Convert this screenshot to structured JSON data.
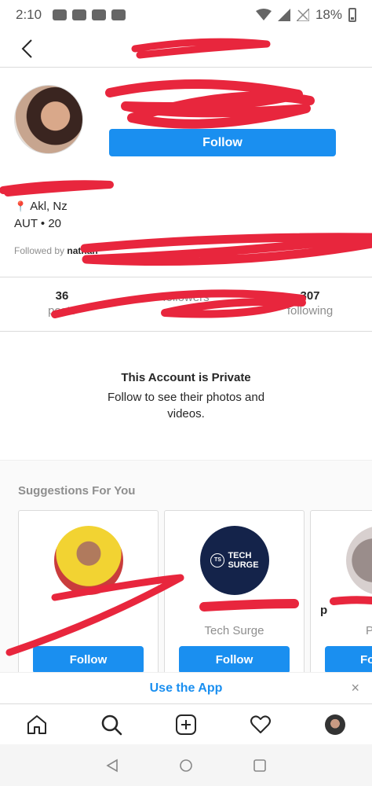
{
  "status_bar": {
    "time": "2:10",
    "battery": "18%"
  },
  "header": {
    "username": ""
  },
  "profile": {
    "follow_label": "Follow",
    "location": "Akl, Nz",
    "info": "AUT • 20",
    "followed_by_prefix": "Followed by",
    "followed_by_name": "nathan"
  },
  "stats": [
    {
      "num": "36",
      "label": "posts"
    },
    {
      "num": "",
      "label": "followers"
    },
    {
      "num": "307",
      "label": "following"
    }
  ],
  "private": {
    "title": "This Account is Private",
    "subtitle": "Follow to see their photos and videos."
  },
  "suggestions": {
    "title": "Suggestions For You",
    "cards": [
      {
        "name": "",
        "sub": "",
        "follow_label": "Follow"
      },
      {
        "name": "",
        "sub": "Tech Surge",
        "follow_label": "Follow",
        "logo_top": "TECH",
        "logo_bottom": "SURGE",
        "logo_mark": "TS"
      },
      {
        "name": "p",
        "sub": "P",
        "follow_label": "Fo"
      }
    ]
  },
  "app_banner": {
    "label": "Use the App",
    "close": "×"
  },
  "colors": {
    "accent": "#1a8ff0",
    "redaction": "#e8263d",
    "pin": "#e2322f"
  }
}
